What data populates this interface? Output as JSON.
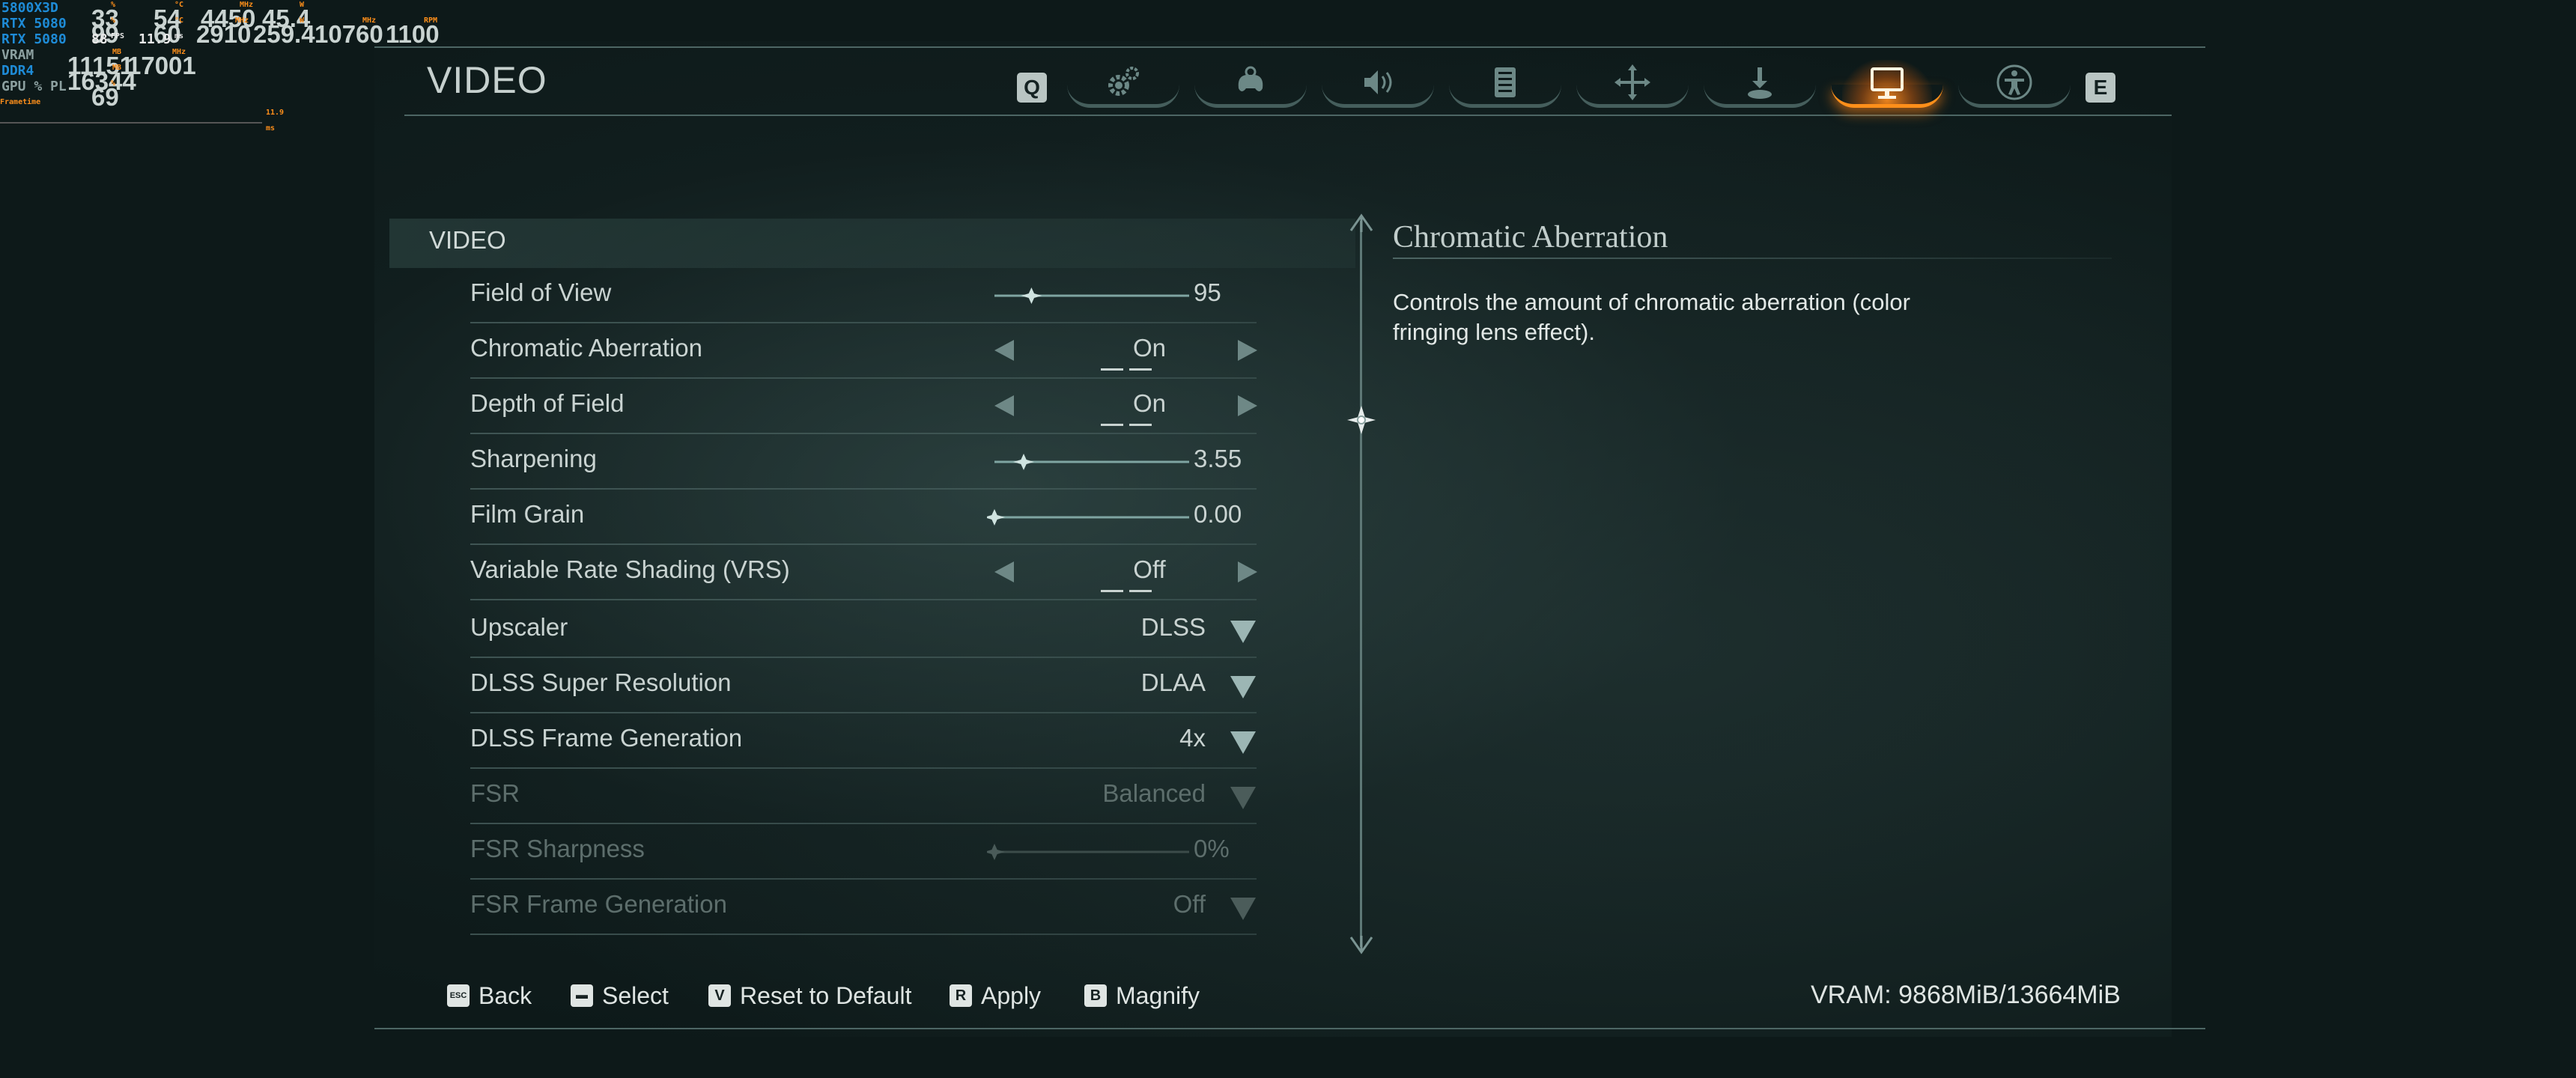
{
  "osd": {
    "rows": [
      {
        "label": "5800X3D",
        "v1": "33",
        "u1": "%",
        "v2": "54",
        "u2": "°C",
        "v3": "4450",
        "u3": "MHz",
        "v4": "45.4",
        "u4": "W"
      },
      {
        "label": "RTX 5080",
        "v1": "99",
        "u1": "%",
        "v2": "60",
        "u2": "°C",
        "v3": "2910",
        "u3": "MHz",
        "v4": "259.4",
        "u4": "W",
        "v5": "10760",
        "u5": "MHz",
        "v6": "1100",
        "u6": "RPM"
      },
      {
        "label": "RTX 5080",
        "v1": "88",
        "u1": "FPS",
        "v2": "11.9",
        "u2": "ms"
      },
      {
        "label": "VRAM",
        "v1": "11151",
        "u1": "MB",
        "v2": "17001",
        "u2": "MHz"
      },
      {
        "label": "DDR4",
        "v1": "16344",
        "u1": "MB"
      },
      {
        "label": "GPU % PL",
        "v1": "69",
        "u1": "%"
      }
    ],
    "frametime_label": "Frametime",
    "frametime_value": "11.9 ms"
  },
  "header": {
    "title": "VIDEO",
    "prev_key": "Q",
    "next_key": "E",
    "tabs": [
      {
        "icon": "gears-icon"
      },
      {
        "icon": "gamepad-gear-icon"
      },
      {
        "icon": "speaker-icon"
      },
      {
        "icon": "list-icon"
      },
      {
        "icon": "move-arrows-icon"
      },
      {
        "icon": "joystick-icon"
      },
      {
        "icon": "monitor-icon",
        "active": true
      },
      {
        "icon": "accessibility-icon"
      }
    ]
  },
  "section": {
    "label": "VIDEO"
  },
  "settings": [
    {
      "label": "Field of View",
      "type": "slider",
      "value": "95",
      "level": 0.19
    },
    {
      "label": "Chromatic Aberration",
      "type": "toggle",
      "value": "On"
    },
    {
      "label": "Depth of Field",
      "type": "toggle",
      "value": "On"
    },
    {
      "label": "Sharpening",
      "type": "slider",
      "value": "3.55",
      "level": 0.15
    },
    {
      "label": "Film Grain",
      "type": "slider",
      "value": "0.00",
      "level": 0.0
    },
    {
      "label": "Variable Rate Shading (VRS)",
      "type": "toggle",
      "value": "Off"
    },
    {
      "label": "Upscaler",
      "type": "dropdown",
      "value": "DLSS"
    },
    {
      "label": "DLSS Super Resolution",
      "type": "dropdown",
      "value": "DLAA"
    },
    {
      "label": "DLSS Frame Generation",
      "type": "dropdown",
      "value": "4x"
    },
    {
      "label": "FSR",
      "type": "dropdown",
      "value": "Balanced",
      "disabled": true
    },
    {
      "label": "FSR Sharpness",
      "type": "slider",
      "value": "0%",
      "level": 0.0,
      "disabled": true
    },
    {
      "label": "FSR Frame Generation",
      "type": "dropdown",
      "value": "Off",
      "disabled": true
    }
  ],
  "description": {
    "title": "Chromatic Aberration",
    "text": "Controls the amount of chromatic aberration (color fringing lens effect)."
  },
  "footer": {
    "hints": [
      {
        "key": "ESC",
        "label": "Back"
      },
      {
        "key": "▬",
        "label": "Select"
      },
      {
        "key": "V",
        "label": "Reset to Default"
      },
      {
        "key": "R",
        "label": "Apply"
      },
      {
        "key": "B",
        "label": "Magnify"
      }
    ],
    "vram": "VRAM: 9868MiB/13664MiB"
  },
  "colors": {
    "accent": "#ff8f1a",
    "text": "#c9d3d1",
    "dim": "#5d6e6c",
    "background": "#0d1919"
  }
}
